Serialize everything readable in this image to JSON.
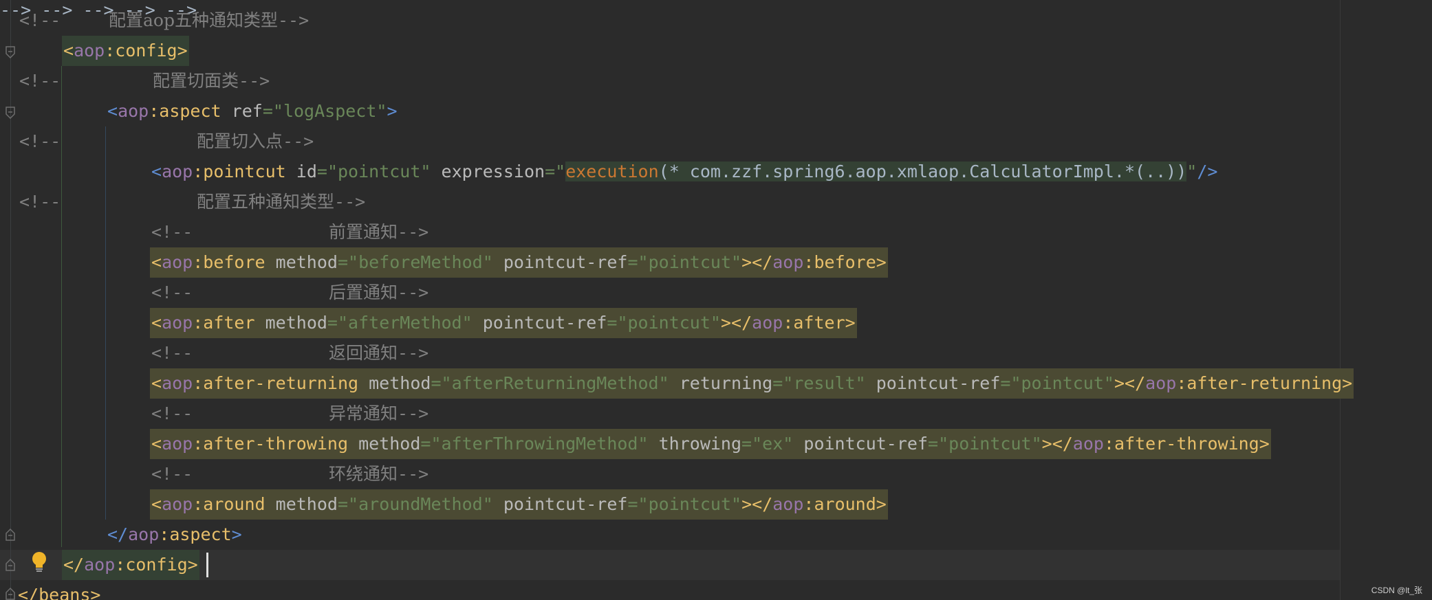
{
  "watermark": "CSDN @lt_张",
  "tokens": {
    "comment_open": "<!--",
    "comment_close": "-->",
    "lt": "<",
    "lt_slash": "</",
    "gt": ">",
    "slash_gt": "/>",
    "colon": ":",
    "ns": "aop",
    "eq": "=",
    "quote": "\""
  },
  "comments": {
    "c1": "配置aop五种通知类型",
    "c2": "配置切面类",
    "c3": "配置切入点",
    "c4": "配置五种通知类型",
    "before": "前置通知",
    "after": "后置通知",
    "returning": "返回通知",
    "throwing": "异常通知",
    "around": "环绕通知"
  },
  "tags": {
    "config": "config",
    "aspect": "aspect",
    "pointcut": "pointcut",
    "before": "before",
    "after": "after",
    "after_returning": "after-returning",
    "after_throwing": "after-throwing",
    "around": "around",
    "beans": "beans"
  },
  "attrs": {
    "ref": "ref",
    "id": "id",
    "expression": "expression",
    "method": "method",
    "pointcut_ref": "pointcut-ref",
    "returning": "returning",
    "throwing": "throwing"
  },
  "values": {
    "log_aspect": "logAspect",
    "pointcut": "pointcut",
    "execution_kw": "execution",
    "execution_rest": "(* com.zzf.spring6.aop.xmlaop.CalculatorImpl.*(..))",
    "before_method": "beforeMethod",
    "after_method": "afterMethod",
    "after_returning_method": "afterReturningMethod",
    "result": "result",
    "after_throwing_method": "afterThrowingMethod",
    "ex": "ex",
    "around_method": "aroundMethod"
  },
  "colors": {
    "background": "#2b2b2b",
    "comment": "#808080",
    "tag": "#e8bf6a",
    "namespace": "#9876aa",
    "attribute": "#bababa",
    "value": "#6a8759",
    "keyword": "#cc7832",
    "highlight_yellow": "#4b4a33",
    "highlight_green": "#344134"
  },
  "icons": {
    "fold": "fold-marker-icon",
    "intention": "lightbulb-icon"
  }
}
